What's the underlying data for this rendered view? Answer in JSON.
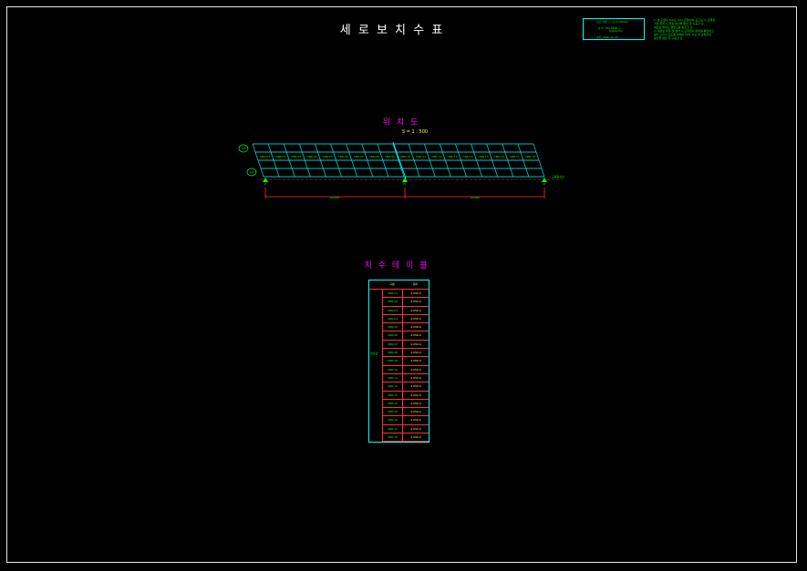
{
  "drawing": {
    "title": "세 로 보 치 수 표",
    "legend": {
      "line1": "교량 : 제천 ○○교 (L=40.0m)",
      "line2": "형 식 : PSC-BEAM 교",
      "line3": "      (2@20.0m)",
      "line4": "설계 : 2010. 00. 00"
    },
    "notes": [
      "1. 본 도면의 치수는 mm 단위이며, 표고는 m 단위임.",
      "   거더 제작 시 현장 여건을 확인 후 시공할 것.",
      "   세로보 위치는 평면도를 참조할 것.",
      "2. 세로보 제작 및 설치 시 교좌장치 위치를 확인하고",
      "   설치 오차가 없도록 하여야 하며, 시공 전 감독관의",
      "   승인을 받은 후 시공할 것."
    ]
  },
  "plan": {
    "title": "위 치 도",
    "scale": "S = 1 : 500",
    "axis_labels": [
      "A1",
      "A2"
    ],
    "right_label": "교량중심선",
    "bay_labels": [
      "CBR-01",
      "CBR-02",
      "CBR-03",
      "CBR-04",
      "CBR-05",
      "CBR-06",
      "CBR-07",
      "CBR-08",
      "CBR-09",
      "CBR-10",
      "CBR-11",
      "CBR-12",
      "CBR-13",
      "CBR-14",
      "CBR-15",
      "CBR-16",
      "CBR-17",
      "CBR-18"
    ],
    "support_labels": [
      "A1",
      "P1",
      "A2"
    ],
    "span_labels": [
      "20,000",
      "20,000"
    ]
  },
  "schedule": {
    "title": "치 수 테 이 블",
    "headers": [
      "구분",
      "길이"
    ],
    "group_label": "세로보",
    "rows": [
      {
        "id": "CBR-01",
        "value": "2,050.0"
      },
      {
        "id": "CBR-02",
        "value": "2,050.0"
      },
      {
        "id": "CBR-03",
        "value": "2,050.0"
      },
      {
        "id": "CBR-04",
        "value": "2,050.0"
      },
      {
        "id": "CBR-05",
        "value": "2,050.0"
      },
      {
        "id": "CBR-06",
        "value": "2,050.0"
      },
      {
        "id": "CBR-07",
        "value": "2,050.0"
      },
      {
        "id": "CBR-08",
        "value": "2,050.0"
      },
      {
        "id": "CBR-09",
        "value": "2,050.0"
      },
      {
        "id": "CBR-10",
        "value": "2,050.0"
      },
      {
        "id": "CBR-11",
        "value": "2,050.0"
      },
      {
        "id": "CBR-12",
        "value": "2,050.0"
      },
      {
        "id": "CBR-13",
        "value": "2,050.0"
      },
      {
        "id": "CBR-14",
        "value": "2,050.0"
      },
      {
        "id": "CBR-15",
        "value": "2,050.0"
      },
      {
        "id": "CBR-16",
        "value": "2,050.0"
      },
      {
        "id": "CBR-17",
        "value": "2,050.0"
      },
      {
        "id": "CBR-18",
        "value": "2,050.0"
      }
    ]
  }
}
